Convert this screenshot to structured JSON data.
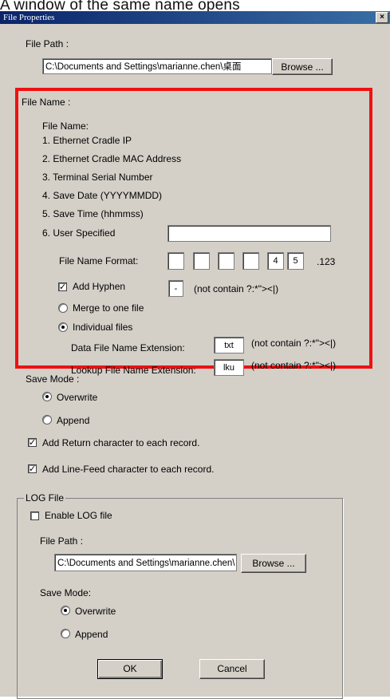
{
  "caption": "A window of the same name opens",
  "dialog": {
    "title": "File Properties",
    "close_icon": "×"
  },
  "file_path": {
    "label": "File Path :",
    "value": "C:\\Documents and Settings\\marianne.chen\\桌面",
    "browse": "Browse ..."
  },
  "file_name": {
    "label": "File Name :",
    "list_title": "File Name:",
    "items": [
      "1. Ethernet Cradle IP",
      "2. Ethernet Cradle MAC Address",
      "3. Terminal Serial Number",
      "4. Save Date (YYYYMMDD)",
      "5. Save Time (hhmmss)",
      "6. User Specified"
    ],
    "user_specified_value": "",
    "format_label": "File Name Format:",
    "format_slots": [
      "",
      "",
      "",
      "",
      "4",
      "5"
    ],
    "format_suffix": ".123",
    "add_hyphen_label": "Add Hyphen",
    "add_hyphen_checked": true,
    "hyphen_value": "-",
    "hyphen_note": "(not contain ?:*\"><|)",
    "merge_label": "Merge to one file",
    "individual_label": "Individual files",
    "individual_selected": true,
    "data_ext_label": "Data File Name Extension:",
    "data_ext_value": "txt",
    "data_ext_note": "(not contain ?:*\"><|)",
    "lookup_ext_label": "Lookup File Name Extension:",
    "lookup_ext_value": "lku",
    "lookup_ext_note": "(not contain ?:*\"><|)"
  },
  "save_mode": {
    "label": "Save Mode :",
    "overwrite": "Overwrite",
    "append": "Append",
    "selected": "Overwrite"
  },
  "add_return": {
    "label": "Add Return character to each record.",
    "checked": true
  },
  "add_linefeed": {
    "label": "Add Line-Feed character to each record.",
    "checked": true
  },
  "log": {
    "group_label": "LOG File",
    "enable_label": "Enable LOG file",
    "enable_checked": false,
    "path_label": "File Path :",
    "path_value": "C:\\Documents and Settings\\marianne.chen\\",
    "browse": "Browse ...",
    "save_mode_label": "Save Mode:",
    "overwrite": "Overwrite",
    "append": "Append",
    "selected": "Overwrite"
  },
  "buttons": {
    "ok": "OK",
    "cancel": "Cancel"
  }
}
